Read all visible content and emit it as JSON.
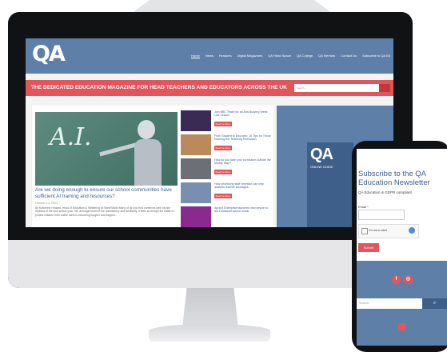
{
  "site": {
    "logo": "QA",
    "nav": [
      "Home",
      "News",
      "Features",
      "Digital Magazines",
      "QA Head Space",
      "QA College",
      "QA Mentors",
      "Contact Us",
      "Subscribe to QA Ed"
    ],
    "tagline": "THE DEDICATED EDUCATION MAGAZINE FOR HEAD TEACHERS AND EDUCATORS ACROSS THE UK",
    "search_placeholder": "Search..."
  },
  "feature": {
    "image_text": "A.I.",
    "title": "Are we doing enough to ensure our school communities have sufficient AI training and resources?",
    "date": "October 14, 2024",
    "excerpt": "By Katherine Howard, Head of Education & Wellbeing at StoneShield  Many of us now find ourselves well into the rhythms of the new school year. Yet, amongst much of the consistency and familiarity, it feels as though the battle to protect children from online harm is becoming tougher and tougher..."
  },
  "side_articles": [
    {
      "title": "Join BBC Teach for an Anti-Bullying Week Live Lesson",
      "button": "Read the Story",
      "thumb_color": "#3a2a55"
    },
    {
      "title": "From Student to Educator: 10 Tips for Those Entering the Teaching Profession",
      "button": "Read the Story",
      "thumb_color": "#b98a5c"
    },
    {
      "title": "How do you take your curriculum outside the Muddy Way?",
      "button": "Read the Story",
      "thumb_color": "#6c6f73"
    },
    {
      "title": "How prioritising staff retention can help address teacher shortages",
      "button": "Read the Story",
      "thumb_color": "#7a8fb0"
    },
    {
      "title": "Apricot Enterprise launches new device to aid enhanced school music",
      "button": "Read the Story",
      "thumb_color": "#8a2a8f"
    }
  ],
  "ad": {
    "logo": "QA",
    "label": "ONLINE GUIDE",
    "footer": "Online Guide"
  },
  "phone": {
    "title": "Subscribe to the QA Education Newsletter",
    "gdpr": "QA Education is GDPR compliant",
    "email_label": "Email",
    "required_mark": "*",
    "captcha_text": "I'm not a robot",
    "submit": "Submit",
    "search_placeholder": "Search",
    "search_icon": "search-icon",
    "social_icons": [
      "facebook-icon",
      "instagram-icon"
    ]
  },
  "colors": {
    "brand_blue": "#5e7fa8",
    "accent_red": "#e2555a",
    "link_blue": "#3d5f8d"
  }
}
